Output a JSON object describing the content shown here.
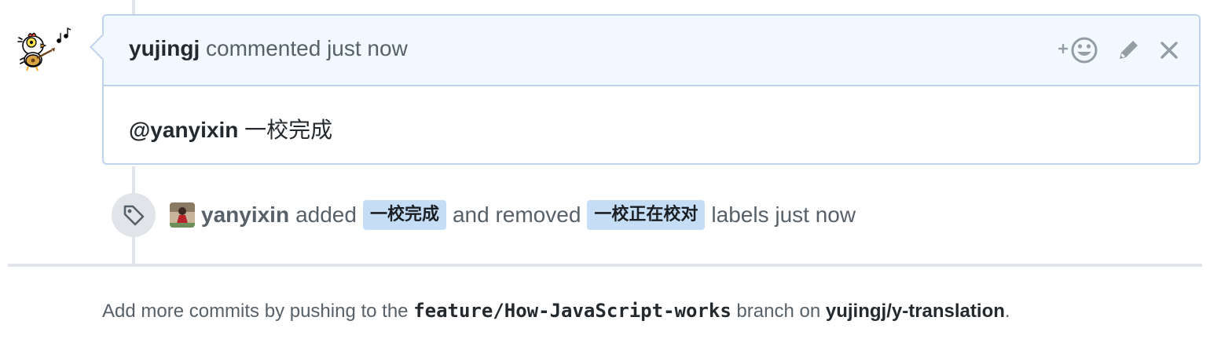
{
  "comment": {
    "author": "yujingj",
    "action_text": " commented just now",
    "body_mention": "@yanyixin",
    "body_text": " 一校完成",
    "actions": {
      "reaction_icon": "add-reaction-icon",
      "edit_icon": "pencil-icon",
      "delete_icon": "close-icon"
    }
  },
  "label_event": {
    "icon": "tag-icon",
    "actor": "yanyixin",
    "added_word": "added",
    "added_label": "一校完成",
    "removed_word": "and removed",
    "removed_label": "一校正在校对",
    "suffix": "labels just now"
  },
  "footer": {
    "prefix": "Add more commits by pushing to the ",
    "branch": "feature/How-JavaScript-works",
    "middle": " branch on ",
    "repo": "yujingj/y-translation",
    "suffix": "."
  },
  "colors": {
    "header_bg": "#f1f8ff",
    "border": "#c0d3eb",
    "label_bg": "#c5def5",
    "muted_text": "#586069"
  }
}
